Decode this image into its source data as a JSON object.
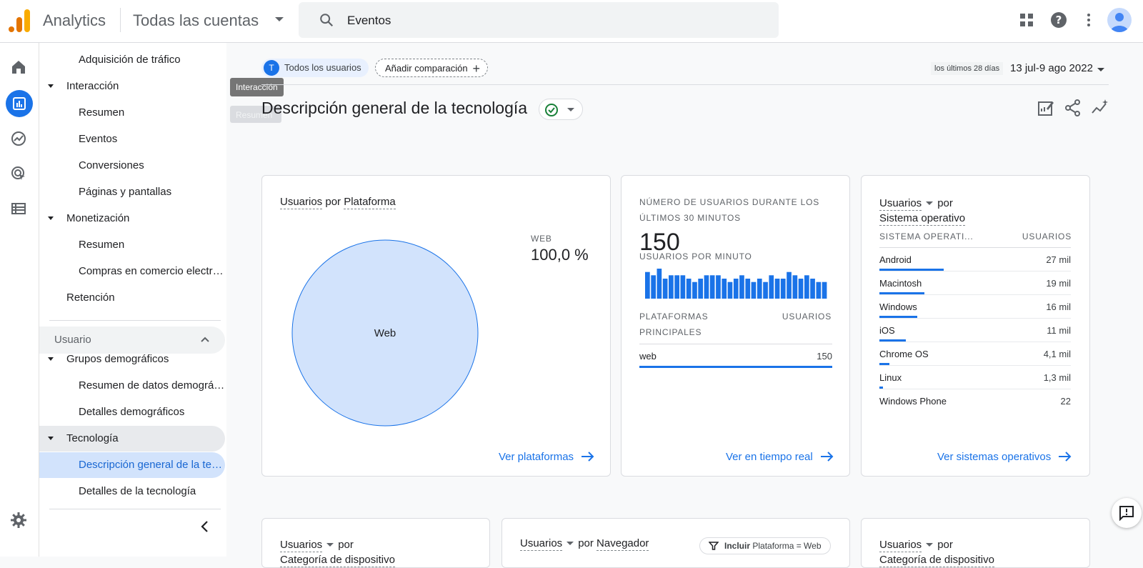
{
  "topbar": {
    "app_name": "Analytics",
    "account": "Todas las cuentas",
    "search_value": "Eventos"
  },
  "nav": {
    "items": [
      {
        "label": "Adquisición de tráfico"
      },
      {
        "label": "Interacción"
      },
      {
        "label": "Resumen"
      },
      {
        "label": "Eventos"
      },
      {
        "label": "Conversiones"
      },
      {
        "label": "Páginas y pantallas"
      },
      {
        "label": "Monetización"
      },
      {
        "label": "Resumen"
      },
      {
        "label": "Compras en comercio electrónico"
      },
      {
        "label": "Retención"
      },
      {
        "label": "Grupos demográficos"
      },
      {
        "label": "Resumen de datos demográficos"
      },
      {
        "label": "Detalles demográficos"
      },
      {
        "label": "Tecnología"
      },
      {
        "label": "Descripción general de la tecnología"
      },
      {
        "label": "Detalles de la tecnología"
      }
    ],
    "section_user": "Usuario"
  },
  "tooltip": {
    "text": "Interacción",
    "ghost": "Resumen"
  },
  "header": {
    "chip_avatar": "T",
    "chip_users": "Todos los usuarios",
    "chip_add": "Añadir comparación",
    "date_badge": "los últimos 28 días",
    "date_range": "13 jul-9 ago 2022",
    "title": "Descripción general de la tecnología"
  },
  "platform_card": {
    "title_metric": "Usuarios",
    "title_by": "por",
    "title_dim": "Plataforma",
    "legend_label": "WEB",
    "legend_value": "100,0 %",
    "slice_label": "Web",
    "link": "Ver plataformas"
  },
  "realtime_card": {
    "title_line1": "NÚMERO DE USUARIOS DURANTE LOS",
    "title_line2": "ÚLTIMOS 30 MINUTOS",
    "count": "150",
    "per_minute_label": "USUARIOS POR MINUTO",
    "table_header_left_1": "PLATAFORMAS",
    "table_header_left_2": "PRINCIPALES",
    "table_header_right": "USUARIOS",
    "row_name": "web",
    "row_value": "150",
    "link": "Ver en tiempo real"
  },
  "os_card": {
    "title_metric": "Usuarios",
    "title_by": "por",
    "title_dim": "Sistema operativo",
    "col_left": "SISTEMA OPERATI...",
    "col_right": "USUARIOS",
    "rows": [
      {
        "name": "Android",
        "value": "27 mil",
        "share": 1.0
      },
      {
        "name": "Macintosh",
        "value": "19 mil",
        "share": 0.7
      },
      {
        "name": "Windows",
        "value": "16 mil",
        "share": 0.59
      },
      {
        "name": "iOS",
        "value": "11 mil",
        "share": 0.41
      },
      {
        "name": "Chrome OS",
        "value": "4,1 mil",
        "share": 0.15
      },
      {
        "name": "Linux",
        "value": "1,3 mil",
        "share": 0.05
      },
      {
        "name": "Windows Phone",
        "value": "22",
        "share": 0.0
      }
    ],
    "link": "Ver sistemas operativos"
  },
  "bottom_cards": [
    {
      "metric": "Usuarios",
      "by": "por",
      "dim": "Categoría de dispositivo"
    },
    {
      "metric": "Usuarios",
      "by": "por",
      "dim": "Navegador",
      "filter_include": "Incluir",
      "filter_text": "Plataforma = Web"
    },
    {
      "metric": "Usuarios",
      "by": "por",
      "dim": "Categoría de dispositivo"
    }
  ],
  "chart_data": [
    {
      "type": "pie",
      "title": "Usuarios por Plataforma",
      "categories": [
        "Web"
      ],
      "values": [
        100.0
      ],
      "colors": [
        "#d2e3fc"
      ]
    },
    {
      "type": "bar",
      "title": "USUARIOS POR MINUTO",
      "values": [
        8,
        7,
        9,
        6,
        7,
        7,
        7,
        6,
        5,
        6,
        7,
        7,
        7,
        6,
        5,
        6,
        7,
        6,
        5,
        6,
        5,
        7,
        6,
        6,
        8,
        7,
        6,
        7,
        6,
        5,
        5
      ],
      "color": "#1a73e8"
    }
  ],
  "colors": {
    "accent": "#1a73e8",
    "pie_fill": "#d2e3fc",
    "success": "#188038"
  }
}
